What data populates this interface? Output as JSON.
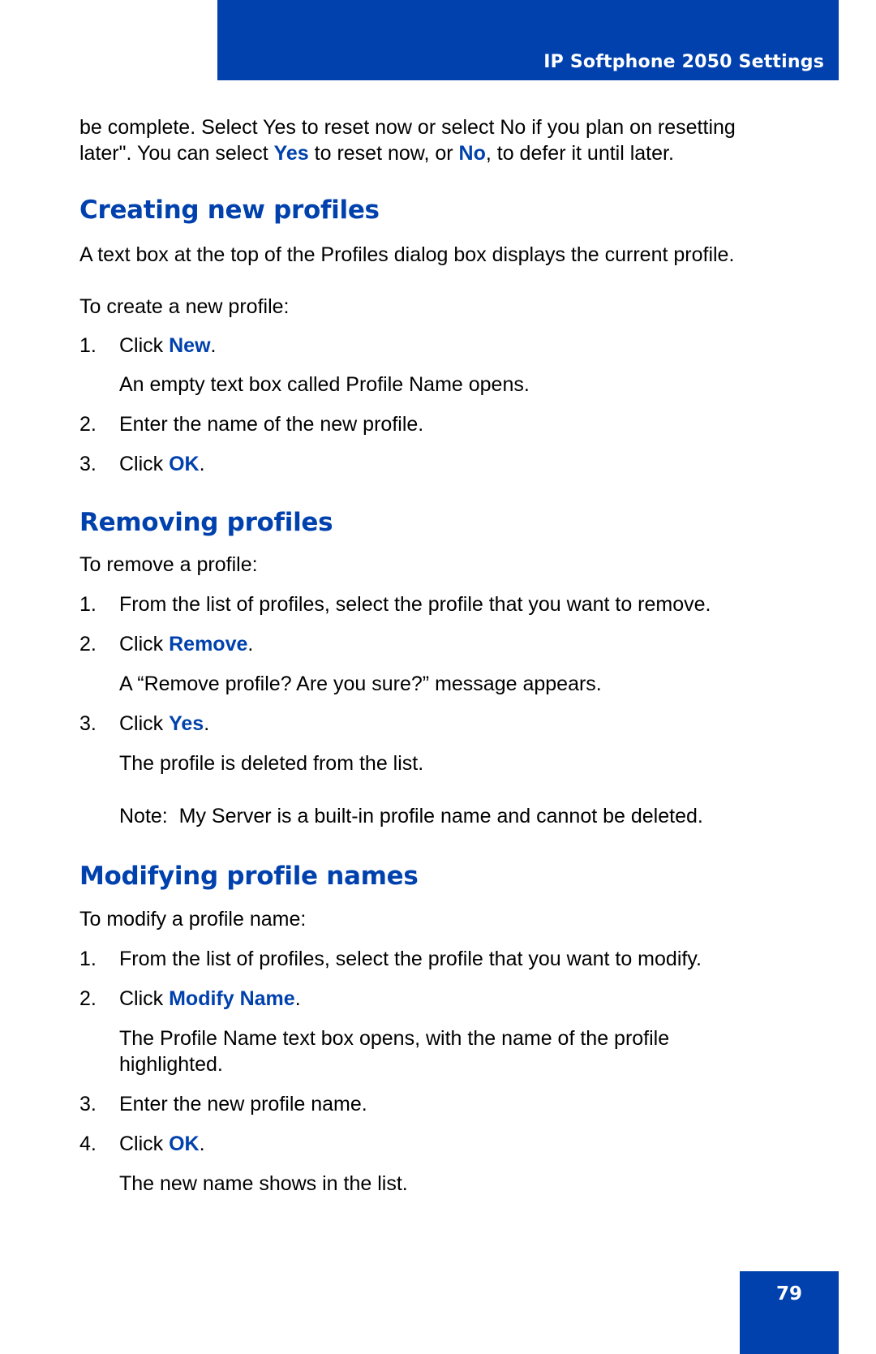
{
  "header": {
    "title": "IP Softphone 2050 Settings",
    "accent_color": "#0041ad"
  },
  "intro": {
    "line1": "be complete. Select Yes to reset now or select No if you plan on resetting",
    "line2_a": "later\". You can select ",
    "line2_yes": "Yes",
    "line2_b": " to reset now, or ",
    "line2_no": "No",
    "line2_c": ", to defer it until later."
  },
  "sections": {
    "create": {
      "heading": "Creating new profiles",
      "description": "A text box at the top of the Profiles dialog box displays the current profile.",
      "lead": "To create a new profile:",
      "steps": [
        {
          "num": "1.",
          "prefix": "Click ",
          "ui": "New",
          "suffix": ".",
          "result": "An empty text box called Profile Name opens."
        },
        {
          "num": "2.",
          "text": "Enter the name of the new profile."
        },
        {
          "num": "3.",
          "prefix": "Click ",
          "ui": "OK",
          "suffix": "."
        }
      ]
    },
    "remove": {
      "heading": "Removing profiles",
      "lead": "To remove a profile:",
      "steps": [
        {
          "num": "1.",
          "text": "From the list of profiles, select the profile that you want to remove."
        },
        {
          "num": "2.",
          "prefix": "Click ",
          "ui": "Remove",
          "suffix": ".",
          "result": "A “Remove profile? Are you sure?” message appears."
        },
        {
          "num": "3.",
          "prefix": "Click ",
          "ui": "Yes",
          "suffix": ".",
          "result": "The profile is deleted from the list."
        }
      ],
      "note": "Note:  My Server is a built-in profile name and cannot be deleted."
    },
    "modify": {
      "heading": "Modifying profile names",
      "lead": "To modify a profile name:",
      "steps": [
        {
          "num": "1.",
          "text": "From the list of profiles, select the profile that you want to modify."
        },
        {
          "num": "2.",
          "prefix": "Click ",
          "ui": "Modify Name",
          "suffix": ".",
          "result_line1": "The Profile Name text box opens, with the name of the profile",
          "result_line2": "highlighted."
        },
        {
          "num": "3.",
          "text": "Enter the new profile name."
        },
        {
          "num": "4.",
          "prefix": "Click ",
          "ui": "OK",
          "suffix": ".",
          "result": "The new name shows in the list."
        }
      ]
    }
  },
  "footer": {
    "page_number": "79"
  }
}
